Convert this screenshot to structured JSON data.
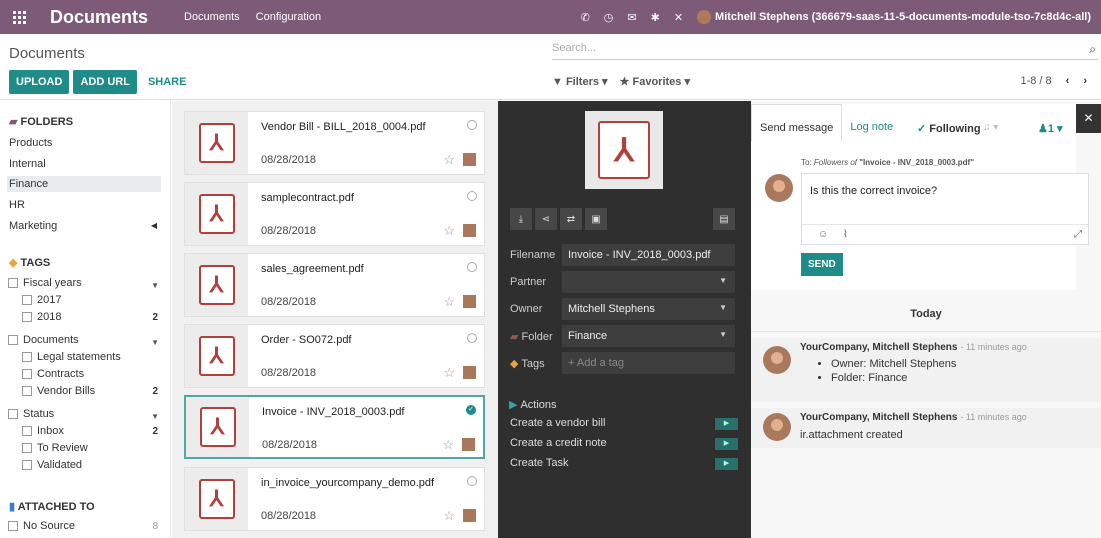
{
  "navbar": {
    "app_title": "Documents",
    "menu": [
      "Documents",
      "Configuration"
    ],
    "icons": [
      "phone-icon",
      "clock-icon",
      "chat-icon",
      "bug-icon",
      "tools-icon"
    ],
    "user": "Mitchell Stephens (366679-saas-11-5-documents-module-tso-7c8d4c-all)"
  },
  "control_panel": {
    "title": "Documents",
    "upload": "UPLOAD",
    "add_url": "ADD URL",
    "share": "SHARE",
    "search_placeholder": "Search...",
    "filters": "Filters",
    "favorites": "Favorites",
    "pager": "1-8 / 8"
  },
  "sidebar": {
    "folders_title": "FOLDERS",
    "folders": [
      "Products",
      "Internal",
      "Finance",
      "HR",
      "Marketing"
    ],
    "active_folder": "Finance",
    "tags_title": "TAGS",
    "tag_groups": [
      {
        "label": "Fiscal years",
        "items": [
          {
            "label": "2017",
            "count": ""
          },
          {
            "label": "2018",
            "count": "2"
          }
        ]
      },
      {
        "label": "Documents",
        "items": [
          {
            "label": "Legal statements",
            "count": ""
          },
          {
            "label": "Contracts",
            "count": ""
          },
          {
            "label": "Vendor Bills",
            "count": "2"
          }
        ]
      },
      {
        "label": "Status",
        "items": [
          {
            "label": "Inbox",
            "count": "2"
          },
          {
            "label": "To Review",
            "count": ""
          },
          {
            "label": "Validated",
            "count": ""
          }
        ]
      }
    ],
    "attached_title": "ATTACHED TO",
    "no_source": "No Source",
    "no_source_count": "8"
  },
  "documents": [
    {
      "name": "Vendor Bill - BILL_2018_0004.pdf",
      "date": "08/28/2018",
      "selected": false
    },
    {
      "name": "samplecontract.pdf",
      "date": "08/28/2018",
      "selected": false
    },
    {
      "name": "sales_agreement.pdf",
      "date": "08/28/2018",
      "selected": false
    },
    {
      "name": "Order - SO072.pdf",
      "date": "08/28/2018",
      "selected": false
    },
    {
      "name": "Invoice - INV_2018_0003.pdf",
      "date": "08/28/2018",
      "selected": true
    },
    {
      "name": "in_invoice_yourcompany_demo.pdf",
      "date": "08/28/2018",
      "selected": false
    }
  ],
  "inspector": {
    "filename_label": "Filename",
    "filename": "Invoice - INV_2018_0003.pdf",
    "partner_label": "Partner",
    "partner": "",
    "owner_label": "Owner",
    "owner": "Mitchell Stephens",
    "folder_label": "Folder",
    "folder": "Finance",
    "tags_label": "Tags",
    "tags_placeholder": "+ Add a tag",
    "actions_title": "Actions",
    "actions": [
      "Create a vendor bill",
      "Create a credit note",
      "Create Task"
    ]
  },
  "chatter": {
    "tab_send": "Send message",
    "tab_log": "Log note",
    "following": "Following",
    "followers_count": "1",
    "to_prefix": "To:",
    "to_followers": "Followers of",
    "to_doc": "\"Invoice - INV_2018_0003.pdf\"",
    "composer_text": "Is this the correct invoice?",
    "send": "SEND",
    "today": "Today",
    "messages": [
      {
        "author": "YourCompany, Mitchell Stephens",
        "time": "- 11 minutes ago",
        "bullets": [
          "Owner: Mitchell Stephens",
          "Folder: Finance"
        ],
        "body": ""
      },
      {
        "author": "YourCompany, Mitchell Stephens",
        "time": "- 11 minutes ago",
        "bullets": [],
        "body": "ir.attachment created"
      }
    ]
  }
}
